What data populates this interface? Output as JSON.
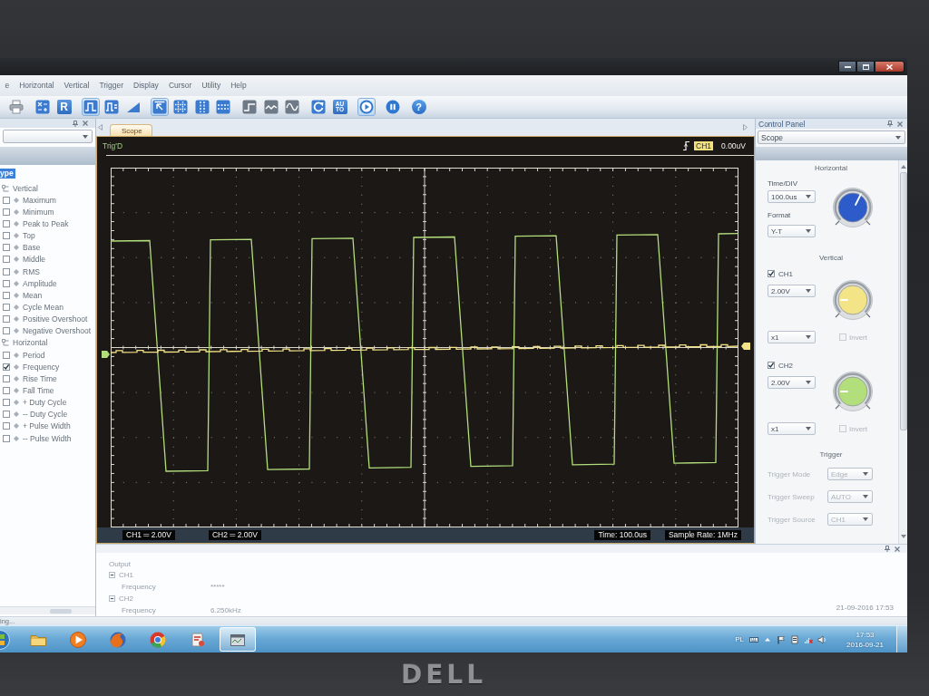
{
  "menu": [
    "e",
    "Horizontal",
    "Vertical",
    "Trigger",
    "Display",
    "Cursor",
    "Utility",
    "Help"
  ],
  "toolbar": [
    {
      "items": [
        {
          "kind": "printer",
          "selected": false
        }
      ]
    },
    {
      "items": [
        {
          "kind": "math",
          "selected": false
        },
        {
          "kind": "letter",
          "label": "R",
          "selected": false
        }
      ]
    },
    {
      "items": [
        {
          "kind": "pulse",
          "selected": true
        },
        {
          "kind": "pulse_step",
          "selected": false
        },
        {
          "kind": "ramp",
          "selected": false
        }
      ]
    },
    {
      "items": [
        {
          "kind": "pointer",
          "selected": true
        },
        {
          "kind": "grid",
          "selected": false
        },
        {
          "kind": "vlines",
          "selected": false
        },
        {
          "kind": "hlines",
          "selected": false
        }
      ]
    },
    {
      "items": [
        {
          "kind": "step",
          "selected": false
        },
        {
          "kind": "wave",
          "selected": false
        },
        {
          "kind": "sine",
          "selected": false
        }
      ]
    },
    {
      "items": [
        {
          "kind": "refresh",
          "selected": false
        },
        {
          "kind": "auto",
          "label": "AU TO",
          "selected": false
        }
      ]
    },
    {
      "items": [
        {
          "kind": "play",
          "selected": true
        },
        {
          "kind": "pause",
          "selected": false
        },
        {
          "kind": "help",
          "label": "?",
          "selected": false
        }
      ]
    }
  ],
  "measure_panel": {
    "header": "ype",
    "tree": [
      {
        "label": "Vertical",
        "children": [
          {
            "label": "Maximum",
            "checked": false
          },
          {
            "label": "Minimum",
            "checked": false
          },
          {
            "label": "Peak to Peak",
            "checked": false
          },
          {
            "label": "Top",
            "checked": false
          },
          {
            "label": "Base",
            "checked": false
          },
          {
            "label": "Middle",
            "checked": false
          },
          {
            "label": "RMS",
            "checked": false
          },
          {
            "label": "Amplitude",
            "checked": false
          },
          {
            "label": "Mean",
            "checked": false
          },
          {
            "label": "Cycle Mean",
            "checked": false
          },
          {
            "label": "Positive Overshoot",
            "checked": false
          },
          {
            "label": "Negative Overshoot",
            "checked": false
          }
        ]
      },
      {
        "label": "Horizontal",
        "children": [
          {
            "label": "Period",
            "checked": false
          },
          {
            "label": "Frequency",
            "checked": true
          },
          {
            "label": "Rise Time",
            "checked": false
          },
          {
            "label": "Fall Time",
            "checked": false
          },
          {
            "label": "+ Duty Cycle",
            "checked": false
          },
          {
            "label": "-- Duty Cycle",
            "checked": false
          },
          {
            "label": "+ Pulse Width",
            "checked": false
          },
          {
            "label": "-- Pulse Width",
            "checked": false
          }
        ]
      }
    ]
  },
  "scope": {
    "tabs": [
      {
        "label": "Scope",
        "selected": true
      }
    ],
    "status": "Trig'D",
    "trigger_source": "CH1",
    "trigger_level": "0.00uV",
    "channels": [
      {
        "label": "CH1 ═ 2.00V"
      },
      {
        "label": "CH2 ═ 2.00V"
      }
    ],
    "time": "Time: 100.0us",
    "sample_rate": "Sample Rate: 1MHz"
  },
  "control_panel": {
    "title": "Control Panel",
    "selector": "Scope",
    "sections": [
      {
        "kind": "horizontal",
        "title": "Horizontal",
        "fields": [
          {
            "label": "Time/DIV",
            "value": "100.0us"
          },
          {
            "label": "Format",
            "value": "Y-T"
          }
        ]
      },
      {
        "kind": "vertical",
        "title": "Vertical",
        "channels": [
          {
            "name": "CH1",
            "checked": true,
            "color": "#f4e488",
            "scale": "2.00V",
            "probe": "x1",
            "invert": {
              "label": "Invert",
              "checked": false,
              "disabled": true
            }
          },
          {
            "name": "CH2",
            "checked": true,
            "color": "#b2de7c",
            "scale": "2.00V",
            "probe": "x1",
            "invert": {
              "label": "Invert",
              "checked": false,
              "disabled": true
            }
          }
        ]
      },
      {
        "kind": "trigger",
        "title": "Trigger",
        "rows": [
          {
            "label": "Trigger Mode",
            "value": "Edge",
            "disabled": true
          },
          {
            "label": "Trigger Sweep",
            "value": "AUTO",
            "disabled": true
          },
          {
            "label": "Trigger Source",
            "value": "CH1",
            "disabled": true
          }
        ]
      }
    ]
  },
  "output_panel": {
    "title": "Output",
    "channels": [
      {
        "name": "CH1",
        "expanded": true,
        "rows": [
          {
            "label": "Frequency",
            "value": "*****"
          }
        ]
      },
      {
        "name": "CH2",
        "expanded": true,
        "rows": [
          {
            "label": "Frequency",
            "value": "6.250kHz"
          }
        ]
      }
    ],
    "timestamp": "21-09-2016 17:53"
  },
  "status_bar": {
    "text": "ing..."
  },
  "taskbar": {
    "apps": [
      {
        "kind": "folder",
        "selected": false
      },
      {
        "kind": "media",
        "selected": false
      },
      {
        "kind": "globe",
        "selected": false
      },
      {
        "kind": "ring",
        "selected": false
      },
      {
        "kind": "tool",
        "selected": false
      },
      {
        "kind": "window",
        "selected": true
      }
    ],
    "language": "PL",
    "time": "17:53",
    "date": "2016-09-21"
  },
  "bezel": {
    "logo": "DELL"
  }
}
